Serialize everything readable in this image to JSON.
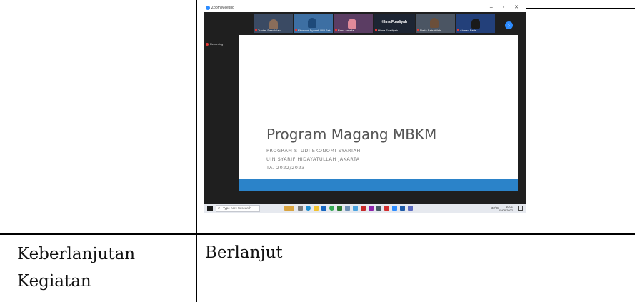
{
  "table": {
    "row2": {
      "label": "Keberlanjutan Kegiatan",
      "label_line1": "Keberlanjutan",
      "label_line2": "Kegiatan",
      "value": "Berlanjut"
    }
  },
  "zoom": {
    "window_title": "Zoom Meeting",
    "window_controls": "–  ▫  ✕",
    "recording_label": "Recording",
    "participants": [
      {
        "name": "Tuntas Salsabilah"
      },
      {
        "name": "Ekonomi Syariah UIN Jak..."
      },
      {
        "name": "Erina Amelia"
      },
      {
        "name": "Hilma Fuadiyah"
      },
      {
        "name": "Nada Salsabilah"
      },
      {
        "name": "Ahmad Faris"
      }
    ],
    "speaker_name": "Hilma Fuadiyah",
    "next_icon_glyph": "›",
    "slide": {
      "title": "Program Magang MBKM",
      "subtitle_lines": [
        "PROGRAM STUDI EKONOMI SYARIAH",
        "UIN SYARIF HIDAYATULLAH JAKARTA",
        "TA. 2022/2023"
      ]
    },
    "taskbar": {
      "search_placeholder": "Type here to search",
      "weather": "32°C",
      "time": "10:01",
      "date": "15/08/2022"
    }
  }
}
